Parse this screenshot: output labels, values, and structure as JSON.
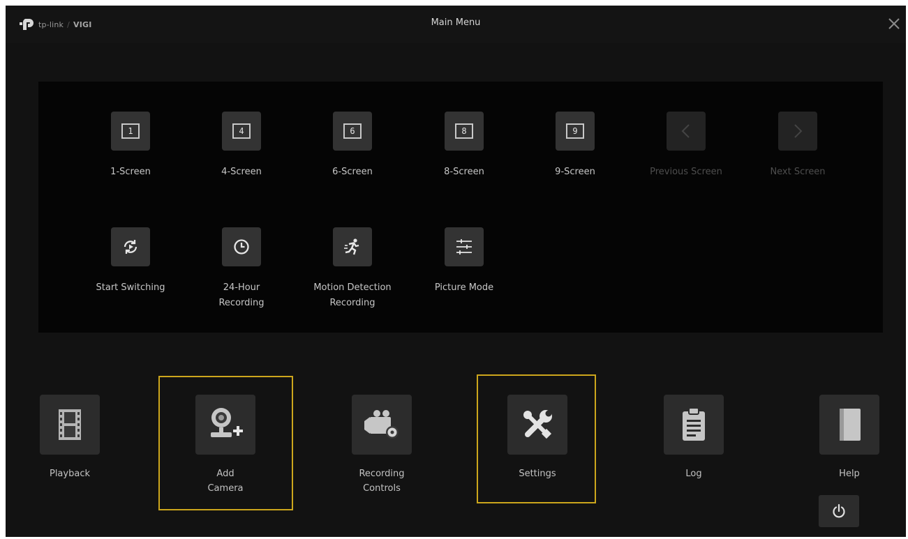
{
  "titlebar": {
    "brand": "tp-link",
    "product": "VIGI",
    "title": "Main Menu"
  },
  "screen_modes": [
    {
      "label": "1-Screen",
      "number": "1",
      "disabled": false
    },
    {
      "label": "4-Screen",
      "number": "4",
      "disabled": false
    },
    {
      "label": "6-Screen",
      "number": "6",
      "disabled": false
    },
    {
      "label": "8-Screen",
      "number": "8",
      "disabled": false
    },
    {
      "label": "9-Screen",
      "number": "9",
      "disabled": false
    },
    {
      "label": "Previous Screen",
      "disabled": true
    },
    {
      "label": "Next Screen",
      "disabled": true
    }
  ],
  "quick_actions": [
    {
      "label_line1": "Start Switching",
      "label_line2": ""
    },
    {
      "label_line1": "24-Hour",
      "label_line2": "Recording"
    },
    {
      "label_line1": "Motion Detection",
      "label_line2": "Recording"
    },
    {
      "label_line1": "Picture Mode",
      "label_line2": ""
    }
  ],
  "main_items": [
    {
      "line1": "Playback",
      "line2": "",
      "icon": "film-icon"
    },
    {
      "line1": "Add",
      "line2": "Camera",
      "icon": "add-camera-icon",
      "highlighted": true
    },
    {
      "line1": "Recording",
      "line2": "Controls",
      "icon": "video-camera-icon"
    },
    {
      "line1": "Settings",
      "line2": "",
      "icon": "tools-icon",
      "highlighted": true
    },
    {
      "line1": "Log",
      "line2": "",
      "icon": "clipboard-icon"
    },
    {
      "line1": "Help",
      "line2": "",
      "icon": "book-icon"
    }
  ],
  "icons": {
    "power": "power-icon",
    "close": "close-icon"
  },
  "colors": {
    "highlight": "#cca61c",
    "background": "#121212",
    "panel": "#050505",
    "tile": "#333333"
  }
}
